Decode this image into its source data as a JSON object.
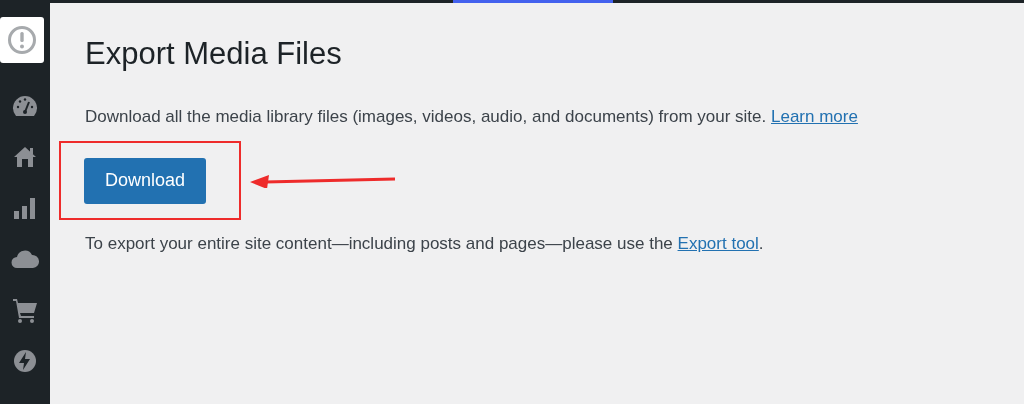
{
  "sidebar": {
    "items": [
      {
        "kind": "alert",
        "selected": true
      },
      {
        "kind": "gauge",
        "selected": false
      },
      {
        "kind": "home",
        "selected": false
      },
      {
        "kind": "chart",
        "selected": false
      },
      {
        "kind": "cloud",
        "selected": false
      },
      {
        "kind": "cart",
        "selected": false
      },
      {
        "kind": "bolt",
        "selected": false
      }
    ]
  },
  "title": "Export Media Files",
  "description": {
    "text": "Download all the media library files (images, videos, audio, and documents) from your site.",
    "link": "Learn more"
  },
  "download_button": "Download",
  "annotation": {
    "color": "#ee2b2b"
  },
  "note": {
    "before": "To export your entire site content—including posts and pages—please use the",
    "link": "Export tool",
    "after": "."
  }
}
